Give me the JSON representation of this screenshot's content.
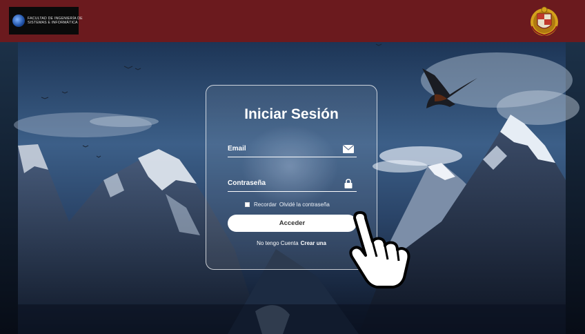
{
  "header": {
    "faculty_logo_line1": "FACULTAD DE INGENIERÍA DE",
    "faculty_logo_line2": "SISTEMAS E INFORMÁTICA",
    "colors": {
      "bar": "#6b1a1e",
      "logo_bg": "#0a0a0a"
    },
    "icons": {
      "left": "globe-icon",
      "right": "university-crest-icon"
    }
  },
  "login": {
    "title": "Iniciar Sesión",
    "email_placeholder": "Email",
    "password_placeholder": "Contraseña",
    "remember_label": "Recordar",
    "forgot_label": "Olvidé la contraseña",
    "submit_label": "Acceder",
    "no_account_text": "No tengo Cuenta",
    "signup_link": "Crear una",
    "icons": {
      "email": "envelope-icon",
      "password": "lock-icon",
      "cursor": "hand-pointer-icon"
    }
  }
}
